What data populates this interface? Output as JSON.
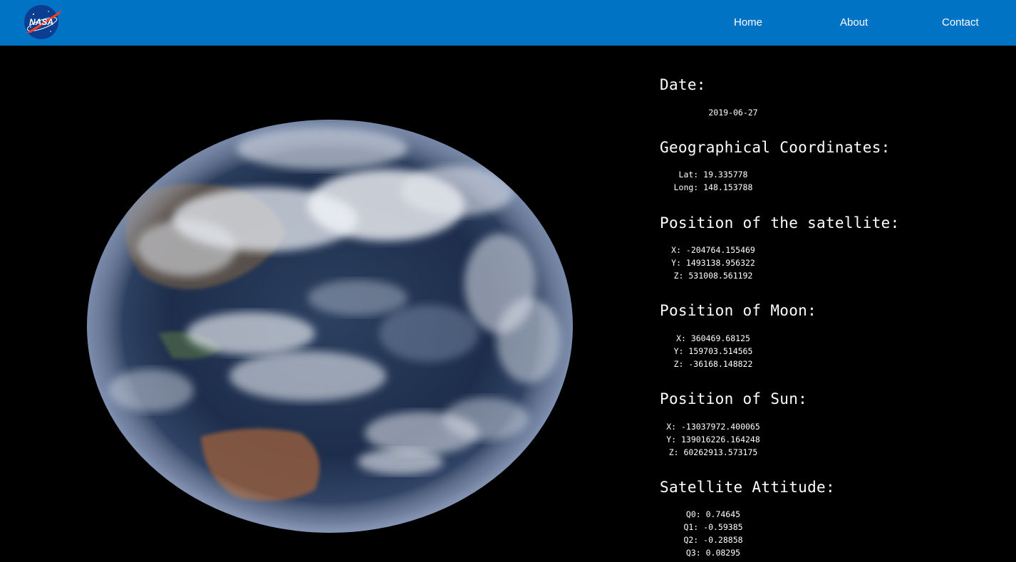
{
  "navbar": {
    "logo_text": "NASA",
    "links": [
      {
        "label": "Home"
      },
      {
        "label": "About"
      },
      {
        "label": "Contact"
      }
    ]
  },
  "info": {
    "date": {
      "heading": "Date:",
      "value": "2019-06-27"
    },
    "geo": {
      "heading": "Geographical Coordinates:",
      "lat": "Lat: 19.335778",
      "long": "Long: 148.153788"
    },
    "satellite": {
      "heading": "Position of the satellite:",
      "x": "X: -204764.155469",
      "y": "Y: 1493138.956322",
      "z": "Z: 531008.561192"
    },
    "moon": {
      "heading": "Position of Moon:",
      "x": "X: 360469.68125",
      "y": "Y: 159703.514565",
      "z": "Z: -36168.148822"
    },
    "sun": {
      "heading": "Position of Sun:",
      "x": "X: -13037972.400065",
      "y": "Y: 139016226.164248",
      "z": "Z: 60262913.573175"
    },
    "attitude": {
      "heading": "Satellite Attitude:",
      "q0": "Q0: 0.74645",
      "q1": "Q1: -0.59385",
      "q2": "Q2: -0.28858",
      "q3": "Q3: 0.08295"
    }
  },
  "colors": {
    "navbar": "#0073c4",
    "background": "#000000",
    "text": "#ffffff"
  },
  "icons": {
    "logo": "nasa-logo-icon"
  }
}
